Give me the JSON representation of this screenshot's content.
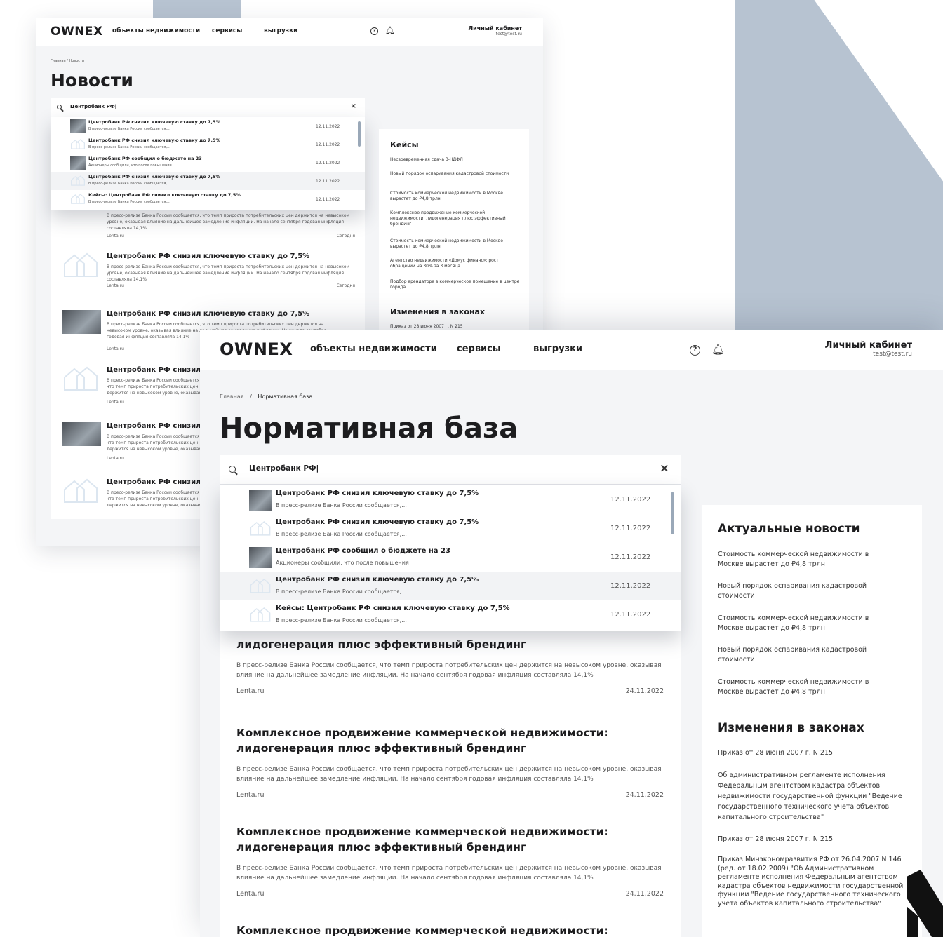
{
  "brand": {
    "logo": "OWNEX"
  },
  "nav": {
    "objects": "объекты недвижимости",
    "services": "сервисы",
    "exports": "выгрузки"
  },
  "account": {
    "title": "Личный кабинет",
    "email": "test@test.ru"
  },
  "window1": {
    "breadcrumb": "Главная  /  Новости",
    "page_title": "Новости",
    "search": {
      "value": "Центробанк РФ|"
    },
    "dropdown": [
      {
        "title": "Центробанк РФ снизил ключевую ставку до 7,5%",
        "snippet": "В пресс-релизе Банка России сообщается,...",
        "date": "12.11.2022",
        "thumb": "photo"
      },
      {
        "title": "Центробанк РФ снизил ключевую ставку до 7,5%",
        "snippet": "В пресс-релизе Банка России сообщается,...",
        "date": "12.11.2022",
        "thumb": "placeholder"
      },
      {
        "title": "Центробанк РФ сообщил о бюджете на 23",
        "snippet": "Акционеры сообщили, что после повышения",
        "date": "12.11.2022",
        "thumb": "photo"
      },
      {
        "title": "Центробанк РФ снизил ключевую ставку до 7,5%",
        "snippet": "В пресс-релизе Банка России сообщается,...",
        "date": "12.11.2022",
        "thumb": "placeholder"
      },
      {
        "title": "Кейсы: Центробанк РФ снизил ключевую ставку до 7,5%",
        "snippet": "В пресс-релизе Банка России сообщается,...",
        "date": "12.11.2022",
        "thumb": "placeholder"
      }
    ],
    "partial_article": {
      "body": "В пресс-релизе Банка России сообщается, что темп прироста потребительских цен держится на невысоком уровне, оказывая влияние на дальнейшее замедление инфляции. На начало сентября годовая инфляция составляла 14,1%",
      "source": "Lenta.ru",
      "date": "Сегодня"
    },
    "articles": [
      {
        "title": "Центробанк РФ снизил ключевую ставку до 7,5%",
        "body": "В пресс-релизе Банка России сообщается, что темп прироста потребительских цен держится на невысоком уровне, оказывая влияние на дальнейшее замедление инфляции. На начало сентября годовая инфляция составляла 14,1%",
        "source": "Lenta.ru",
        "date": "Сегодня",
        "thumb": "placeholder"
      },
      {
        "title": "Центробанк РФ снизил ключевую ставку до 7,5%",
        "body": "В пресс-релизе Банка России сообщается, что темп прироста потребительских цен держится на невысоком уровне, оказывая влияние на дальнейшее замедление инфляции. На начало сентября годовая инфляция составляла 14,1%",
        "source": "Lenta.ru",
        "date": "",
        "thumb": "photo"
      },
      {
        "title": "Центробанк РФ снизил",
        "body": "В пресс-релизе Банка России сообщается, что темп прироста потребительских цен держится на невысоком уровне, оказывая влияние на дальнейшее замедление инфляции. На начало сентября годовая инфляция составляла 14,1%",
        "source": "Lenta.ru",
        "date": "",
        "thumb": "placeholder"
      },
      {
        "title": "Центробанк РФ снизил",
        "body": "В пресс-релизе Банка России сообщается, что темп прироста потребительских цен держится на невысоком уровне, оказывая влияние на дальнейшее замедление инфляции. На начало сентября годовая инфляция составляла 14,1%",
        "source": "Lenta.ru",
        "date": "",
        "thumb": "photo"
      },
      {
        "title": "Центробанк РФ снизил",
        "body": "В пресс-релизе Банка России сообщается, что темп прироста потребительских цен держится на невысоком уровне, оказывая влияние на дальнейшее замедление инфляции. На начало сентября годовая инфляция составляла 14,1%",
        "source": "Lenta.ru",
        "date": "",
        "thumb": "placeholder"
      }
    ],
    "side": {
      "cases_title": "Кейсы",
      "cases": [
        "Несвоевременная сдача 3-НДФЛ",
        "Новый порядок оспаривания кадастровой стоимости",
        "Стоимость коммерческой недвижимости в Москве вырастет до ₽4,8 трлн",
        "Комплексное продвижение коммерческой недвижимости: лидогенерация плюс эффективный брендинг",
        "Стоимость коммерческой недвижимости в Москве вырастет до ₽4,8 трлн",
        "Агентство недвижимости «Домус финанс»: рост обращений на 30% за 3 месяца",
        "Подбор арендатора в коммерческое помещение в центре города"
      ],
      "laws_title": "Изменения в законах",
      "laws_first": "Приказ от 28 июня 2007 г. N 215"
    }
  },
  "window2": {
    "breadcrumb_home": "Главная",
    "breadcrumb_sep": "/",
    "breadcrumb_current": "Нормативная база",
    "page_title": "Нормативная база",
    "search": {
      "value": "Центробанк РФ|"
    },
    "dropdown": [
      {
        "title": "Центробанк РФ снизил ключевую ставку до 7,5%",
        "snippet": "В пресс-релизе Банка России сообщается,...",
        "date": "12.11.2022",
        "thumb": "photo"
      },
      {
        "title": "Центробанк РФ снизил ключевую ставку до 7,5%",
        "snippet": "В пресс-релизе Банка России сообщается,...",
        "date": "12.11.2022",
        "thumb": "placeholder"
      },
      {
        "title": "Центробанк РФ сообщил о бюджете на 23",
        "snippet": "Акционеры сообщили, что после повышения",
        "date": "12.11.2022",
        "thumb": "photo"
      },
      {
        "title": "Центробанк РФ снизил ключевую ставку до 7,5%",
        "snippet": "В пресс-релизе Банка России сообщается,...",
        "date": "12.11.2022",
        "thumb": "placeholder"
      },
      {
        "title": "Кейсы: Центробанк РФ снизил ключевую ставку до 7,5%",
        "snippet": "В пресс-релизе Банка России сообщается,...",
        "date": "12.11.2022",
        "thumb": "placeholder"
      }
    ],
    "articles": [
      {
        "title": "лидогенерация плюс эффективный брендинг",
        "body": "В пресс-релизе Банка России сообщается, что темп прироста потребительских цен держится на невысоком уровне, оказывая влияние на дальнейшее замедление инфляции. На начало сентября годовая инфляция составляла 14,1%",
        "source": "Lenta.ru",
        "date": "24.11.2022"
      },
      {
        "title": "Комплексное продвижение коммерческой недвижимости: лидогенерация плюс эффективный брендинг",
        "body": "В пресс-релизе Банка России сообщается, что темп прироста потребительских цен держится на невысоком уровне, оказывая влияние на дальнейшее замедление инфляции. На начало сентября годовая инфляция составляла 14,1%",
        "source": "Lenta.ru",
        "date": "24.11.2022"
      },
      {
        "title": "Комплексное продвижение коммерческой недвижимости: лидогенерация плюс эффективный брендинг",
        "body": "В пресс-релизе Банка России сообщается, что темп прироста потребительских цен держится на невысоком уровне, оказывая влияние на дальнейшее замедление инфляции. На начало сентября годовая инфляция составляла 14,1%",
        "source": "Lenta.ru",
        "date": "24.11.2022"
      },
      {
        "title": "Комплексное продвижение коммерческой недвижимости:",
        "body": "",
        "source": "",
        "date": ""
      }
    ],
    "side": {
      "news_title": "Актуальные новости",
      "news": [
        "Стоимость коммерческой недвижимости в Москве вырастет до ₽4,8 трлн",
        "Новый порядок оспаривания кадастровой стоимости",
        "Стоимость коммерческой недвижимости в Москве вырастет до ₽4,8 трлн",
        "Новый порядок оспаривания кадастровой стоимости",
        "Стоимость коммерческой недвижимости в Москве вырастет до ₽4,8 трлн"
      ],
      "laws_title": "Изменения в законах",
      "laws": [
        "Приказ от 28 июня 2007 г. N 215",
        "Об административном регламенте исполнения Федеральным агентством кадастра объектов недвижимости государственной функции \"Ведение государственного технического учета объектов капитального строительства\"",
        "Приказ от 28 июня 2007 г. N 215",
        "Приказ Минэкономразвития РФ от 26.04.2007 N 146 (ред. от 18.02.2009) \"Об Административном регламенте исполнения Федеральным агентством кадастра объектов недвижимости государственной функции \"Ведение государственного технического учета объектов капитального строительства\""
      ]
    }
  },
  "colors": {
    "background_shape": "#b7c3d1",
    "page_bg": "#f4f5f7",
    "scrollbar": "#9aa8b8",
    "text": "#1d1d1f"
  }
}
